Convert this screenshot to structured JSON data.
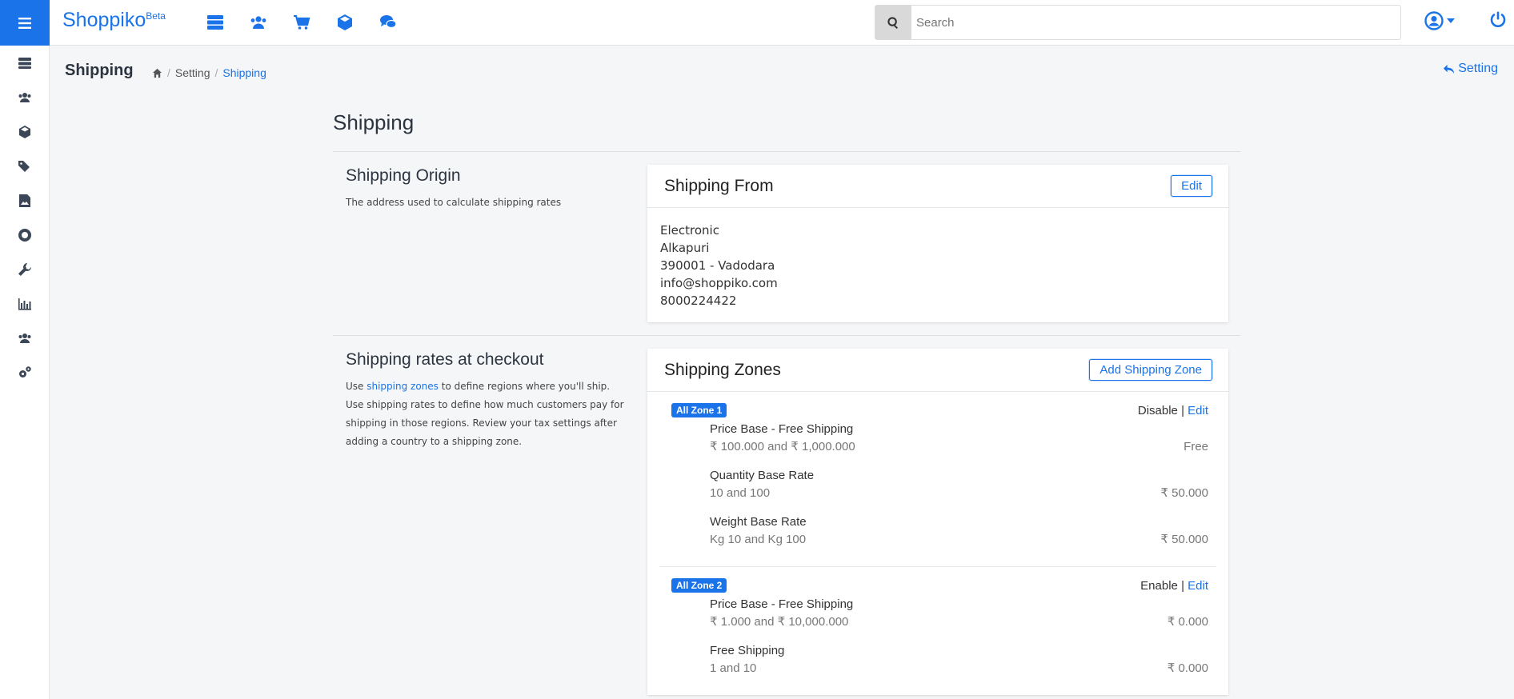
{
  "brand": {
    "name": "Shoppiko",
    "badge": "Beta"
  },
  "search": {
    "placeholder": "Search"
  },
  "page": {
    "title": "Shipping",
    "back_label": "Setting"
  },
  "breadcrumb": {
    "items": [
      "Setting",
      "Shipping"
    ]
  },
  "content": {
    "title": "Shipping",
    "origin": {
      "heading": "Shipping Origin",
      "description": "The address used to calculate shipping rates",
      "card_title": "Shipping From",
      "edit_label": "Edit",
      "address": [
        "Electronic",
        "Alkapuri",
        "390001 - Vadodara",
        "info@shoppiko.com",
        "8000224422"
      ]
    },
    "rates": {
      "heading": "Shipping rates at checkout",
      "desc_before": "Use ",
      "desc_link": "shipping zones",
      "desc_after": " to define regions where you'll ship. Use shipping rates to define how much customers pay for shipping in those regions. Review your tax settings after adding a country to a shipping zone.",
      "card_title": "Shipping Zones",
      "add_label": "Add Shipping Zone",
      "zones": [
        {
          "badge": "All Zone 1",
          "status_action": "Disable",
          "separator": "|",
          "edit_label": "Edit",
          "rates": [
            {
              "name": "Price Base - Free Shipping",
              "range": "₹ 100.000 and ₹ 1,000.000",
              "price": "Free"
            },
            {
              "name": "Quantity Base Rate",
              "range": "10 and 100",
              "price": "₹ 50.000"
            },
            {
              "name": "Weight Base Rate",
              "range": "Kg 10 and Kg 100",
              "price": "₹ 50.000"
            }
          ]
        },
        {
          "badge": "All Zone 2",
          "status_action": "Enable",
          "separator": "|",
          "edit_label": "Edit",
          "rates": [
            {
              "name": "Price Base - Free Shipping",
              "range": "₹ 1.000 and ₹ 10,000.000",
              "price": "₹ 0.000"
            },
            {
              "name": "Free Shipping",
              "range": "1 and 10",
              "price": "₹ 0.000"
            }
          ]
        }
      ]
    }
  },
  "colors": {
    "accent": "#1a73e8",
    "rail_icon": "#3b4757",
    "background": "#f5f6f8"
  }
}
